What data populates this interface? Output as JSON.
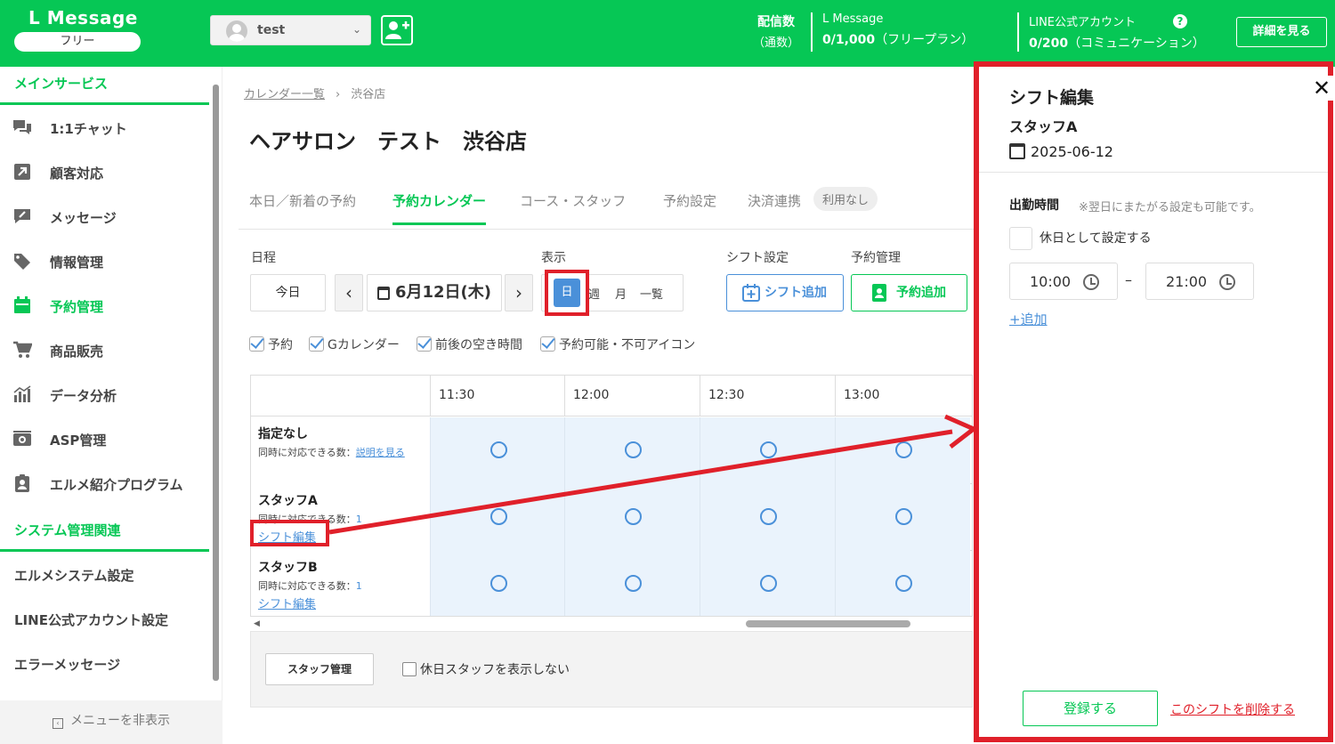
{
  "header": {
    "logo": "L Message",
    "plan": "フリー",
    "account_name": "test",
    "stat_delivery_title": "配信数",
    "stat_delivery_sub": "（通数）",
    "lmessage_label": "L Message",
    "lmessage_count": "0/1,000",
    "lmessage_plan": "（フリープラン）",
    "line_label": "LINE公式アカウント",
    "line_count": "0/200",
    "line_plan": "（コミュニケーション）",
    "help": "?",
    "detail_button": "詳細を見る"
  },
  "sidebar": {
    "section_main": "メインサービス",
    "items": [
      {
        "label": "1:1チャット",
        "icon": "chat-icon"
      },
      {
        "label": "顧客対応",
        "icon": "arrow-up-right-icon"
      },
      {
        "label": "メッセージ",
        "icon": "message-edit-icon"
      },
      {
        "label": "情報管理",
        "icon": "tag-icon"
      },
      {
        "label": "予約管理",
        "icon": "calendar-icon"
      },
      {
        "label": "商品販売",
        "icon": "cart-icon"
      },
      {
        "label": "データ分析",
        "icon": "bar-chart-icon"
      },
      {
        "label": "ASP管理",
        "icon": "asp-icon"
      },
      {
        "label": "エルメ紹介プログラム",
        "icon": "clipboard-user-icon"
      }
    ],
    "section_system": "システム管理関連",
    "system_items": [
      "エルメシステム設定",
      "LINE公式アカウント設定",
      "エラーメッセージ"
    ],
    "hide_menu": "メニューを非表示"
  },
  "main": {
    "breadcrumb_link": "カレンダー一覧",
    "breadcrumb_sep": "›",
    "breadcrumb_current": "渋谷店",
    "title": "ヘアサロン　テスト　渋谷店",
    "tabs": [
      "本日／新着の予約",
      "予約カレンダー",
      "コース・スタッフ",
      "予約設定",
      "決済連携"
    ],
    "tab_pill": "利用なし",
    "schedule_label": "日程",
    "today_button": "今日",
    "prev": "‹",
    "next": "›",
    "date_display": "6月12日(木)",
    "view_label": "表示",
    "view_day": "日",
    "view_week": "週",
    "view_month": "月",
    "view_list": "一覧",
    "shift_settings_label": "シフト設定",
    "shift_add_button": "シフト追加",
    "booking_mgmt_label": "予約管理",
    "booking_add_button": "予約追加",
    "checks": [
      "予約",
      "Gカレンダー",
      "前後の空き時間",
      "予約可能・不可アイコン"
    ],
    "times": [
      "11:30",
      "12:00",
      "12:30",
      "13:00"
    ],
    "rows": [
      {
        "name": "指定なし",
        "cap_label": "同時に対応できる数：",
        "cap_value": "説明を見る",
        "shift": ""
      },
      {
        "name": "スタッフA",
        "cap_label": "同時に対応できる数：",
        "cap_value": "1",
        "shift": "シフト編集"
      },
      {
        "name": "スタッフB",
        "cap_label": "同時に対応できる数：",
        "cap_value": "1",
        "shift": "シフト編集"
      }
    ],
    "staff_mgmt_button": "スタッフ管理",
    "hide_holiday_staff": "休日スタッフを表示しない"
  },
  "panel": {
    "title": "シフト編集",
    "staff": "スタッフA",
    "date": "2025-06-12",
    "work_time_label": "出勤時間",
    "work_time_note": "※翌日にまたがる設定も可能です。",
    "holiday_label": "休日として設定する",
    "start_time": "10:00",
    "end_time": "21:00",
    "dash": "–",
    "add_link": "+追加",
    "register_button": "登録する",
    "delete_link": "このシフトを削除する",
    "close": "✕"
  },
  "colors": {
    "brand": "#06c755",
    "accent_red": "#e0202a",
    "link_blue": "#4a90d9"
  }
}
